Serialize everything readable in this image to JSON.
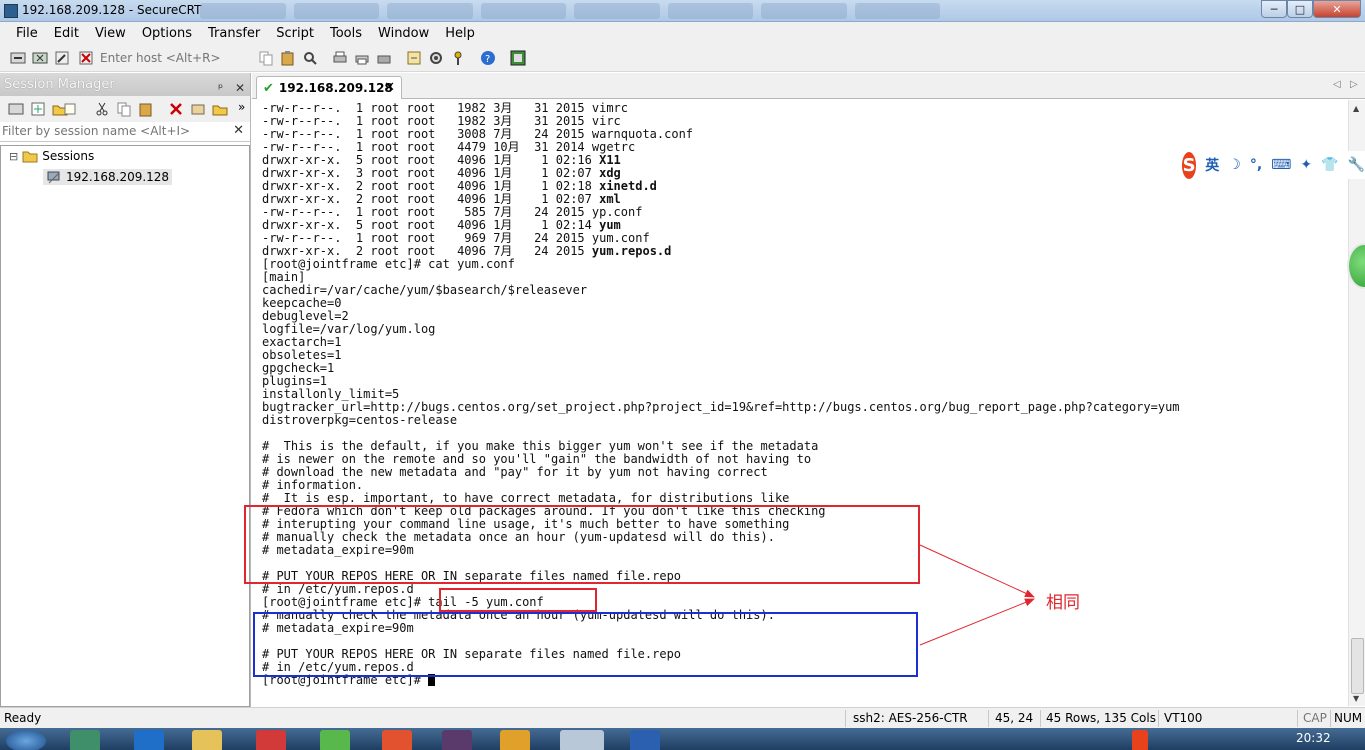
{
  "window": {
    "title": "192.168.209.128 - SecureCRT",
    "min": "─",
    "max": "□",
    "close": "✕"
  },
  "menu": [
    "File",
    "Edit",
    "View",
    "Options",
    "Transfer",
    "Script",
    "Tools",
    "Window",
    "Help"
  ],
  "toolbar": {
    "enter_host_placeholder": "Enter host <Alt+R>"
  },
  "session_manager": {
    "title": "Session Manager",
    "pin": "ᵖ",
    "close": "✕",
    "filter_placeholder": "Filter by session name <Alt+I>",
    "tree_root": "Sessions",
    "tree_expander": "⊟",
    "tree_item": "192.168.209.128"
  },
  "tab": {
    "label": "192.168.209.128",
    "close": "✕",
    "prev": "◁",
    "next": "▷"
  },
  "terminal": {
    "lines": [
      "-rw-r--r--.  1 root root   1982 3月   31 2015 vimrc",
      "-rw-r--r--.  1 root root   1982 3月   31 2015 virc",
      "-rw-r--r--.  1 root root   3008 7月   24 2015 warnquota.conf",
      "-rw-r--r--.  1 root root   4479 10月  31 2014 wgetrc",
      "drwxr-xr-x.  5 root root   4096 1月    1 02:16 |X11",
      "drwxr-xr-x.  3 root root   4096 1月    1 02:07 |xdg",
      "drwxr-xr-x.  2 root root   4096 1月    1 02:18 |xinetd.d",
      "drwxr-xr-x.  2 root root   4096 1月    1 02:07 |xml",
      "-rw-r--r--.  1 root root    585 7月   24 2015 yp.conf",
      "drwxr-xr-x.  5 root root   4096 1月    1 02:14 |yum",
      "-rw-r--r--.  1 root root    969 7月   24 2015 yum.conf",
      "drwxr-xr-x.  2 root root   4096 7月   24 2015 |yum.repos.d",
      "[root@jointframe etc]# cat yum.conf",
      "[main]",
      "cachedir=/var/cache/yum/$basearch/$releasever",
      "keepcache=0",
      "debuglevel=2",
      "logfile=/var/log/yum.log",
      "exactarch=1",
      "obsoletes=1",
      "gpgcheck=1",
      "plugins=1",
      "installonly_limit=5",
      "bugtracker_url=http://bugs.centos.org/set_project.php?project_id=19&ref=http://bugs.centos.org/bug_report_page.php?category=yum",
      "distroverpkg=centos-release",
      "",
      "#  This is the default, if you make this bigger yum won't see if the metadata",
      "# is newer on the remote and so you'll \"gain\" the bandwidth of not having to",
      "# download the new metadata and \"pay\" for it by yum not having correct",
      "# information.",
      "#  It is esp. important, to have correct metadata, for distributions like",
      "# Fedora which don't keep old packages around. If you don't like this checking",
      "# interupting your command line usage, it's much better to have something",
      "# manually check the metadata once an hour (yum-updatesd will do this).",
      "# metadata_expire=90m",
      "",
      "# PUT YOUR REPOS HERE OR IN separate files named file.repo",
      "# in /etc/yum.repos.d",
      "[root@jointframe etc]# tail -5 yum.conf",
      "# manually check the metadata once an hour (yum-updatesd will do this).",
      "# metadata_expire=90m",
      "",
      "# PUT YOUR REPOS HERE OR IN separate files named file.repo",
      "# in /etc/yum.repos.d",
      "[root@jointframe etc]# "
    ]
  },
  "annotation": {
    "label": "相同",
    "color_red": "#e0262e",
    "color_blue": "#1d2fd0"
  },
  "ime": {
    "logo": "S",
    "lang": "英",
    "icons": [
      "☽",
      "°,",
      "⌨",
      "✦",
      "👕",
      "🔧"
    ]
  },
  "status": {
    "ready": "Ready",
    "cipher": "ssh2: AES-256-CTR",
    "position": "45,  24",
    "size": "45 Rows, 135 Cols",
    "term": "VT100",
    "cap": "CAP",
    "num": "NUM"
  },
  "taskbar": {
    "clock": "20:32"
  }
}
